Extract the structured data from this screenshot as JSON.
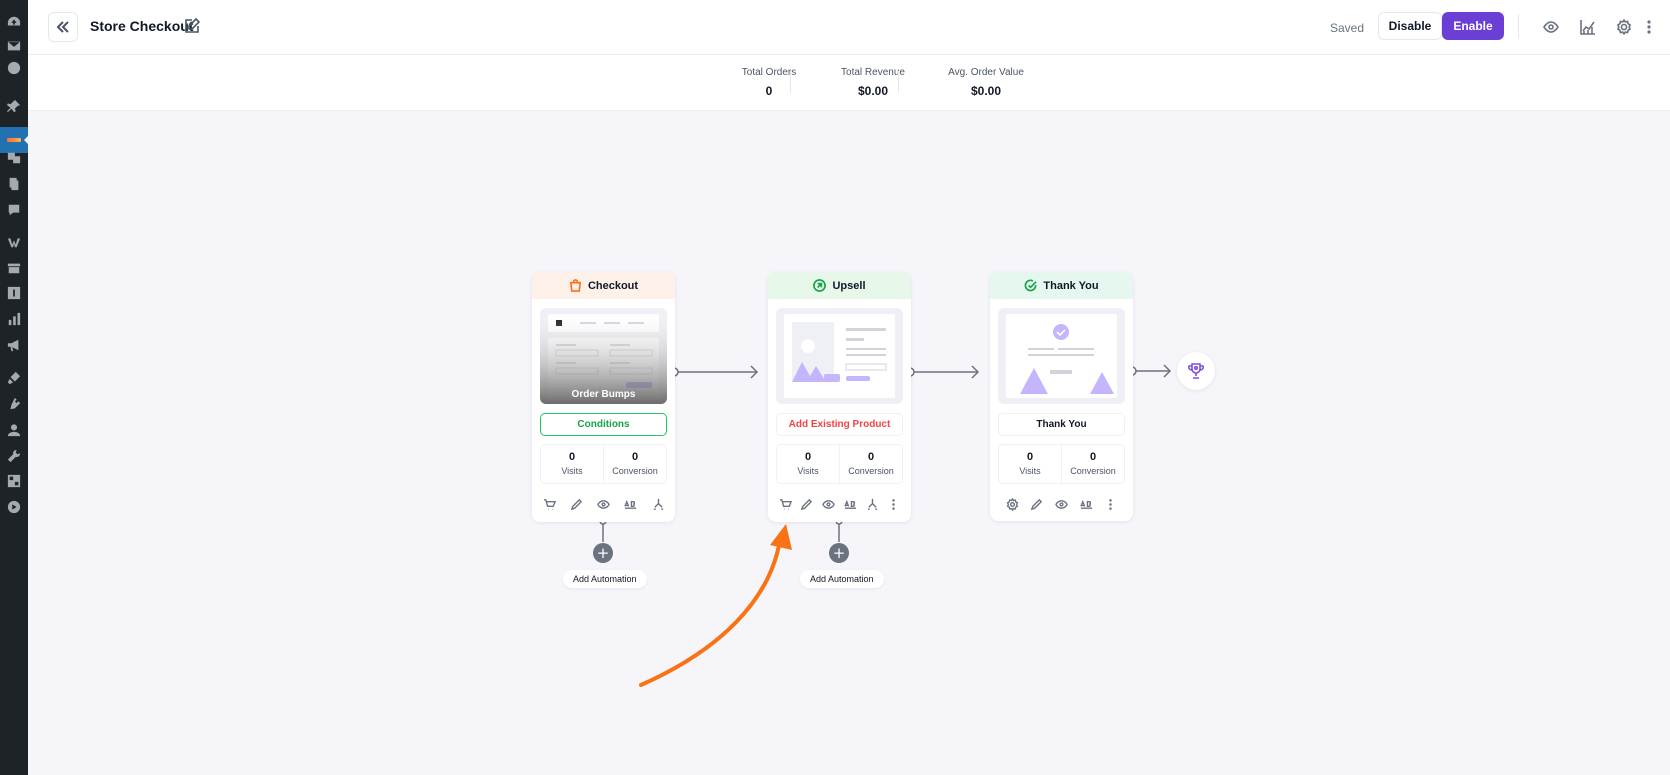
{
  "header": {
    "title": "Store Checkout",
    "status": "Saved",
    "disable_label": "Disable",
    "enable_label": "Enable"
  },
  "stats": [
    {
      "label": "Total Orders",
      "value": "0"
    },
    {
      "label": "Total Revenue",
      "value": "$0.00"
    },
    {
      "label": "Avg. Order Value",
      "value": "$0.00"
    }
  ],
  "steps": {
    "checkout": {
      "title": "Checkout",
      "thumb_caption": "Order Bumps",
      "action": "Conditions",
      "visits_value": "0",
      "visits_label": "Visits",
      "conversion_value": "0",
      "conversion_label": "Conversion",
      "automation_label": "Add Automation",
      "accent": "#fdf1ea"
    },
    "upsell": {
      "title": "Upsell",
      "action": "Add Existing Product",
      "visits_value": "0",
      "visits_label": "Visits",
      "conversion_value": "0",
      "conversion_label": "Conversion",
      "automation_label": "Add Automation",
      "accent": "#e7f7ea"
    },
    "thankyou": {
      "title": "Thank You",
      "action": "Thank You",
      "visits_value": "0",
      "visits_label": "Visits",
      "conversion_value": "0",
      "conversion_label": "Conversion",
      "accent": "#e6f7ef"
    }
  },
  "colors": {
    "primary": "#6b3fd6",
    "annotation_arrow": "#f97316",
    "sidebar": "#1d2327"
  },
  "icons": {
    "sidebar": [
      "dashboard-icon",
      "mail-icon",
      "elementor-icon",
      "pin-icon",
      "funnel-icon",
      "media-icon",
      "pages-icon",
      "comments-icon",
      "woocommerce-icon",
      "products-icon",
      "payments-icon",
      "analytics-icon",
      "marketing-icon",
      "appearance-icon",
      "plugins-icon",
      "users-icon",
      "tools-icon",
      "settings-icon",
      "play-icon"
    ],
    "toolbar": [
      "preview-icon",
      "analytics-chart-icon",
      "gear-icon",
      "more-vertical-icon"
    ]
  }
}
